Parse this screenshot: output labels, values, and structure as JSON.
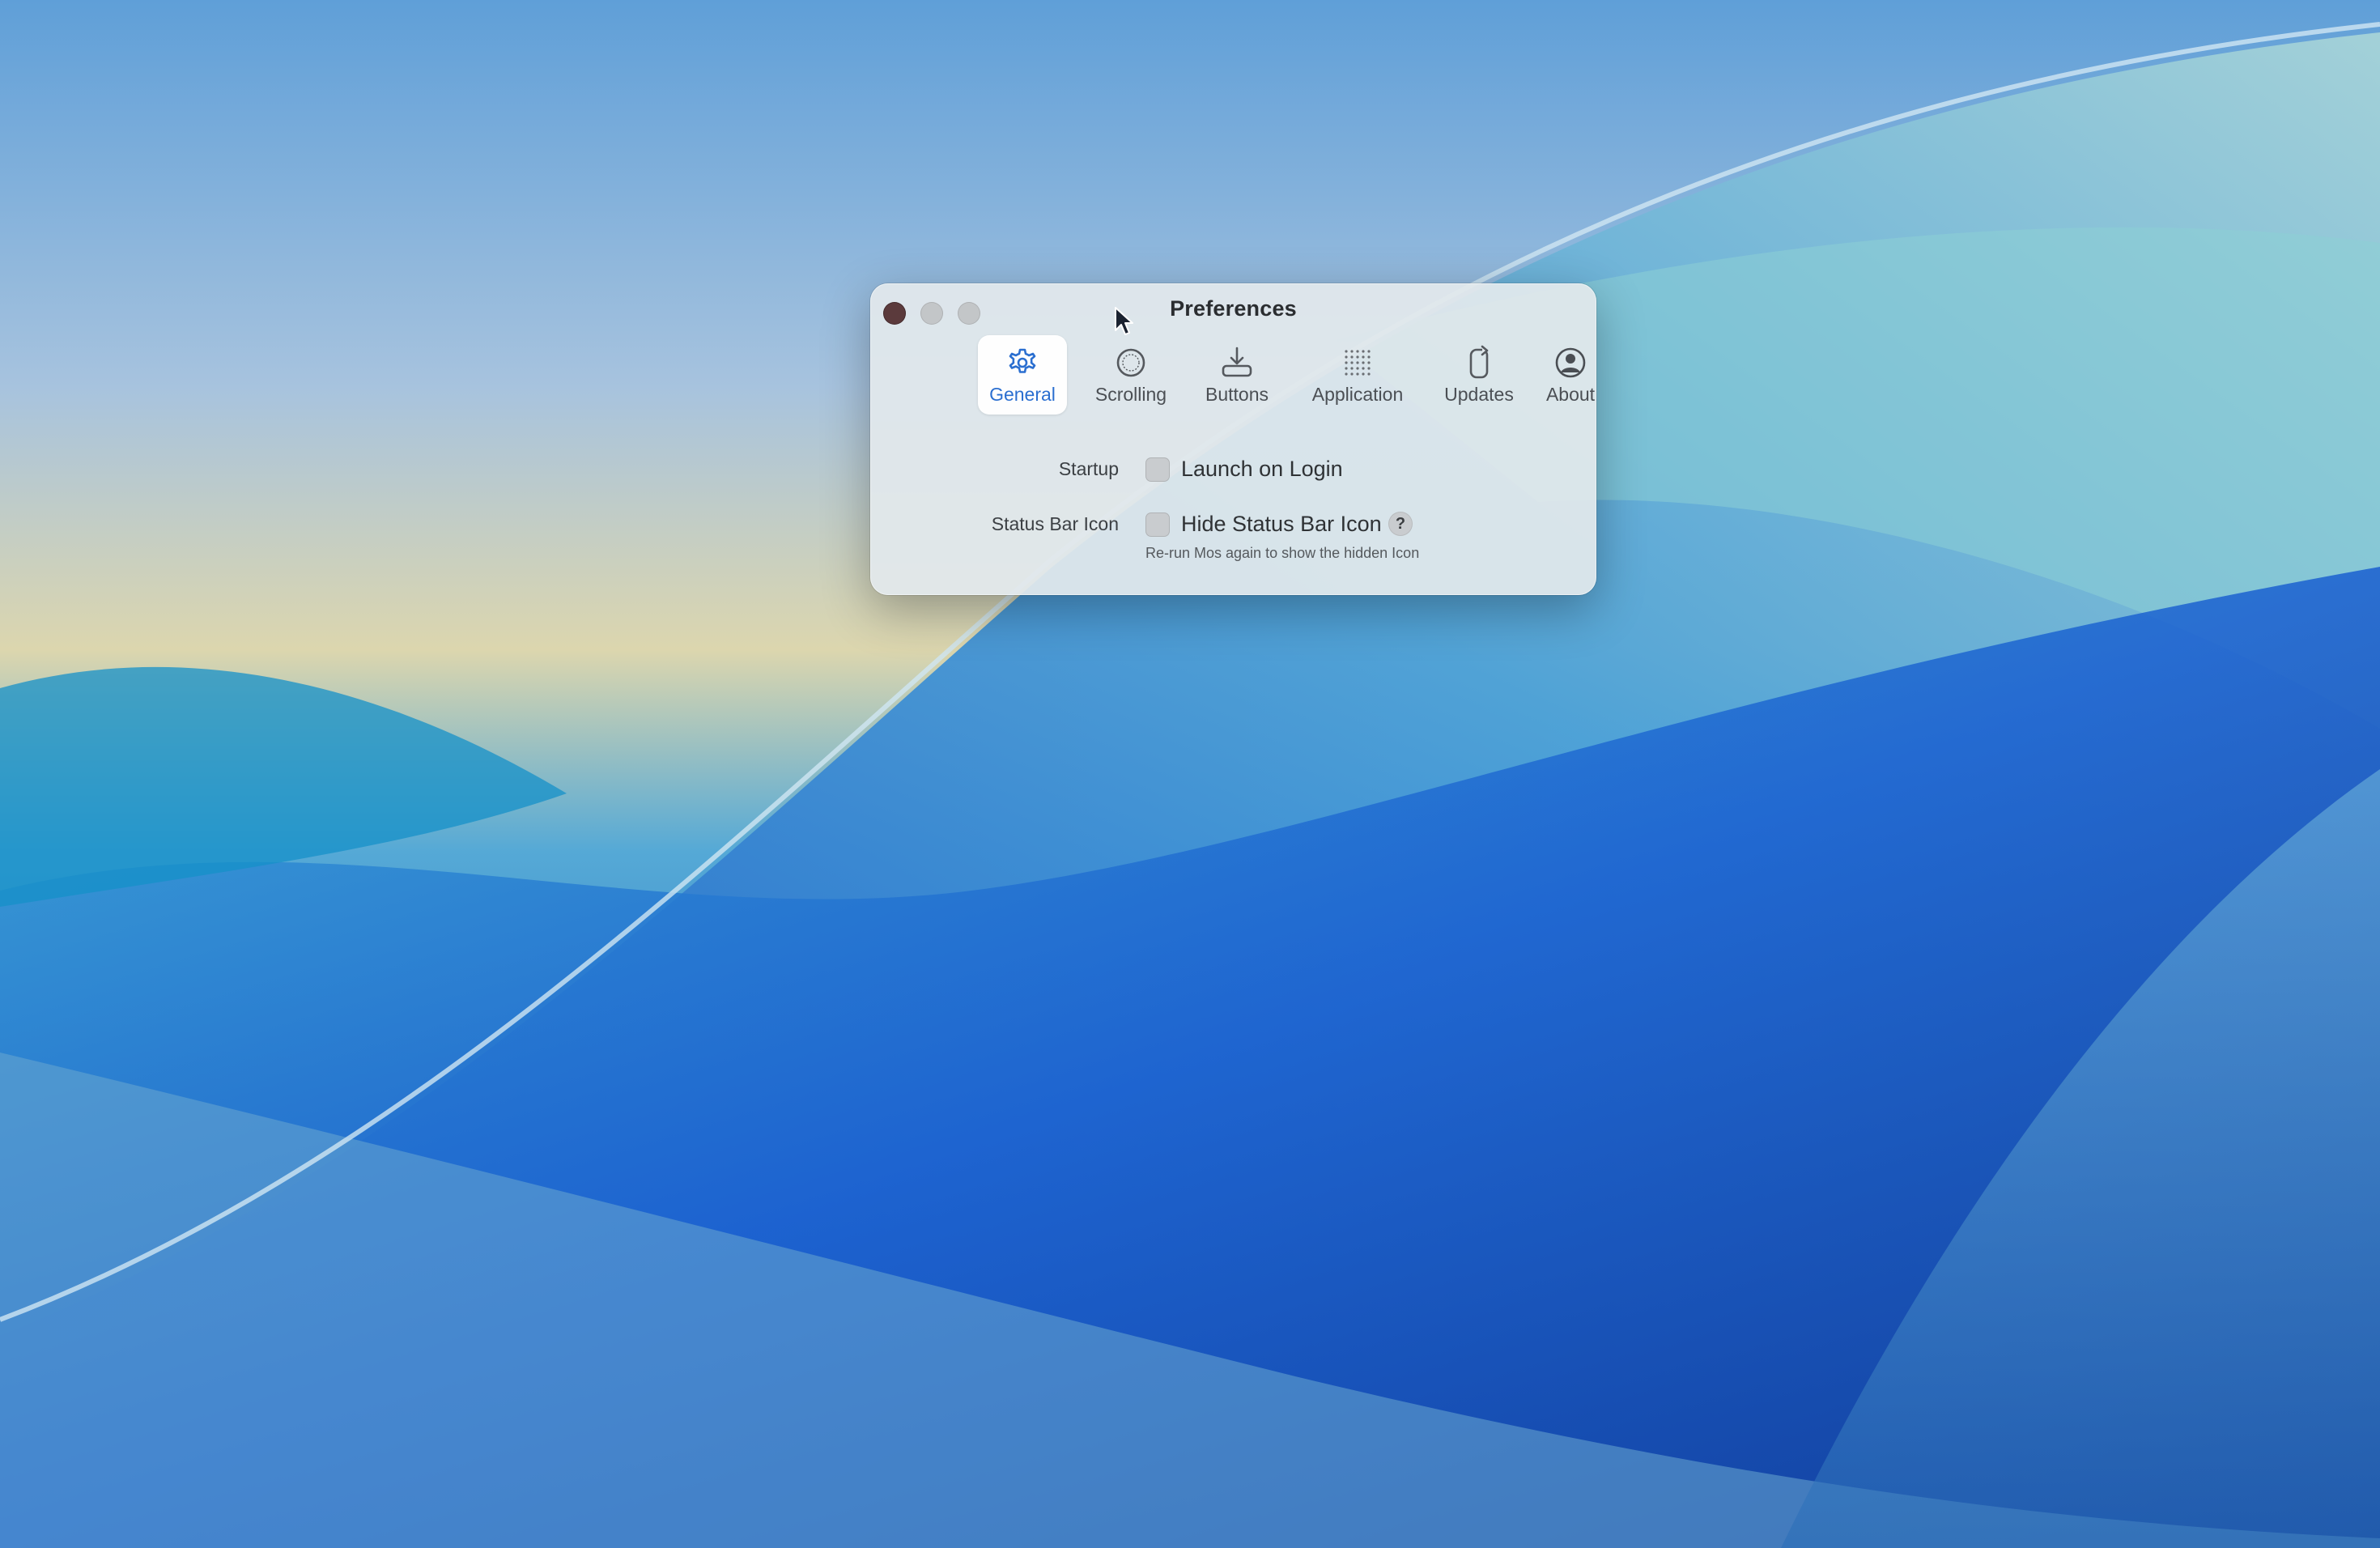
{
  "window": {
    "title": "Preferences"
  },
  "toolbar": {
    "tabs": [
      {
        "label": "General",
        "icon": "gear-icon",
        "active": true
      },
      {
        "label": "Scrolling",
        "icon": "scroll-wheel-icon",
        "active": false
      },
      {
        "label": "Buttons",
        "icon": "mouse-button-icon",
        "active": false
      },
      {
        "label": "Application",
        "icon": "app-grid-icon",
        "active": false
      },
      {
        "label": "Updates",
        "icon": "update-arrow-icon",
        "active": false
      },
      {
        "label": "About",
        "icon": "person-circle-icon",
        "active": false
      }
    ]
  },
  "general": {
    "startup_label": "Startup",
    "launch_on_login": {
      "label": "Launch on Login",
      "checked": false
    },
    "status_bar_label": "Status Bar Icon",
    "hide_status_bar_icon": {
      "label": "Hide Status Bar Icon",
      "checked": false
    },
    "help_glyph": "?",
    "hint": "Re-run Mos again to show the hidden Icon"
  },
  "colors": {
    "accent": "#2b6fd0",
    "close_button": "#5b3a3c"
  }
}
